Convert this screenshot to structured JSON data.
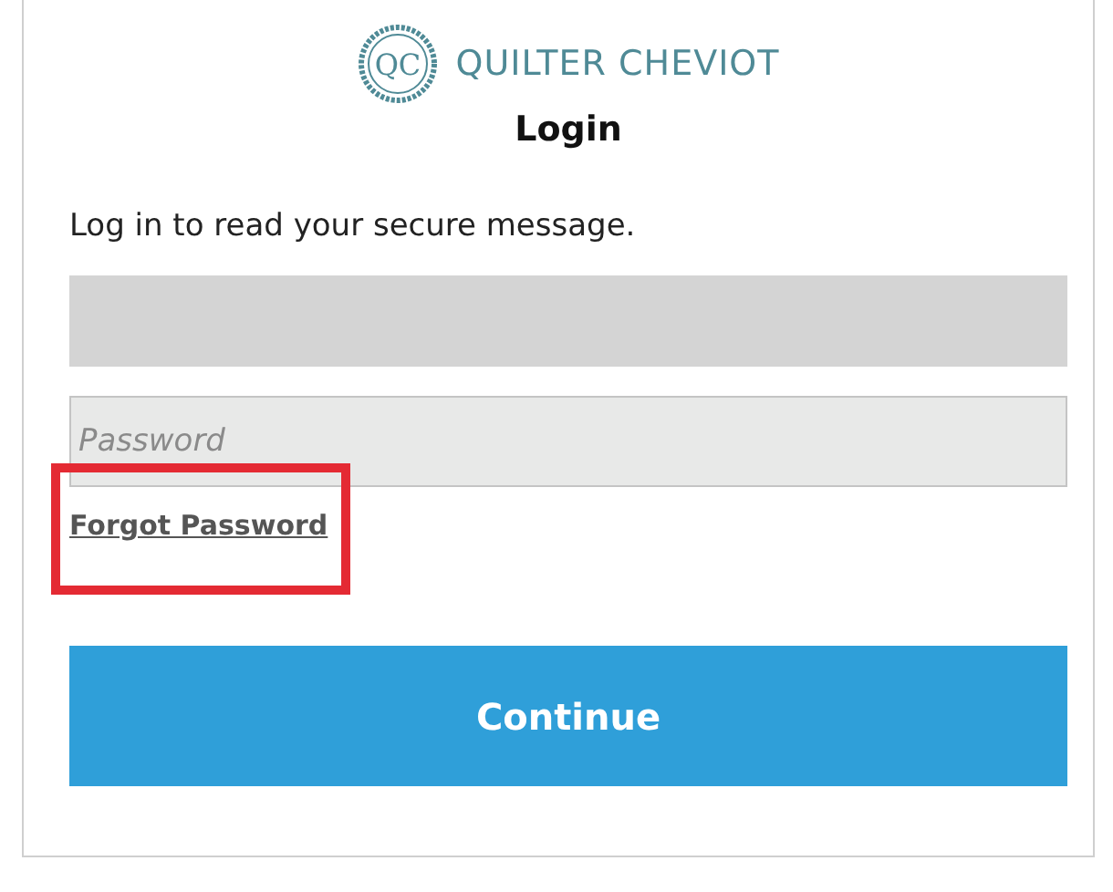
{
  "logo": {
    "monogram": "QC",
    "name": "QUILTER CHEVIOT"
  },
  "title": "Login",
  "intro": "Log in to read your secure message.",
  "fields": [
    {
      "kind": "filled"
    },
    {
      "kind": "empty",
      "placeholder": "Password"
    }
  ],
  "forgot_link": {
    "label": "Forgot Password",
    "highlighted": true
  },
  "button": "Continue"
}
